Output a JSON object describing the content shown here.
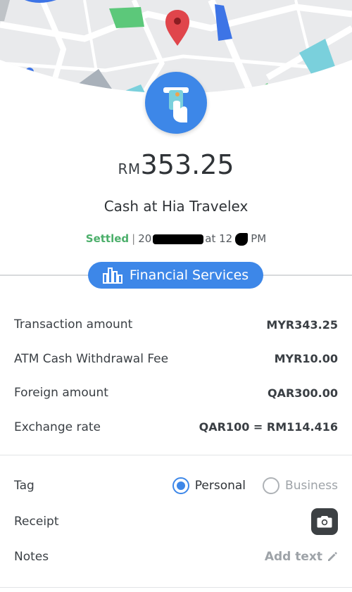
{
  "header": {
    "map_alt": "map-background",
    "atm_icon": "atm-card-hand-icon"
  },
  "summary": {
    "currency_prefix": "RM",
    "amount": "353.25",
    "merchant": "Cash at Hia Travelex",
    "status": "Settled",
    "date_prefix": "20",
    "time_joiner": "at 12",
    "time_suffix": "PM"
  },
  "category": {
    "label": "Financial Services",
    "icon": "bar-chart-icon",
    "color": "#3d87e8"
  },
  "details": [
    {
      "label": "Transaction amount",
      "value": "MYR343.25"
    },
    {
      "label": "ATM Cash Withdrawal Fee",
      "value": "MYR10.00"
    },
    {
      "label": "Foreign amount",
      "value": "QAR300.00"
    },
    {
      "label": "Exchange rate",
      "value": "QAR100 = RM114.416"
    }
  ],
  "tag": {
    "label": "Tag",
    "options": [
      "Personal",
      "Business"
    ],
    "selected": "Personal"
  },
  "receipt": {
    "label": "Receipt",
    "icon": "camera-icon"
  },
  "notes": {
    "label": "Notes",
    "action": "Add text",
    "icon": "pencil-icon"
  },
  "colors": {
    "accent": "#3d87e8",
    "settled": "#4caf6b"
  }
}
